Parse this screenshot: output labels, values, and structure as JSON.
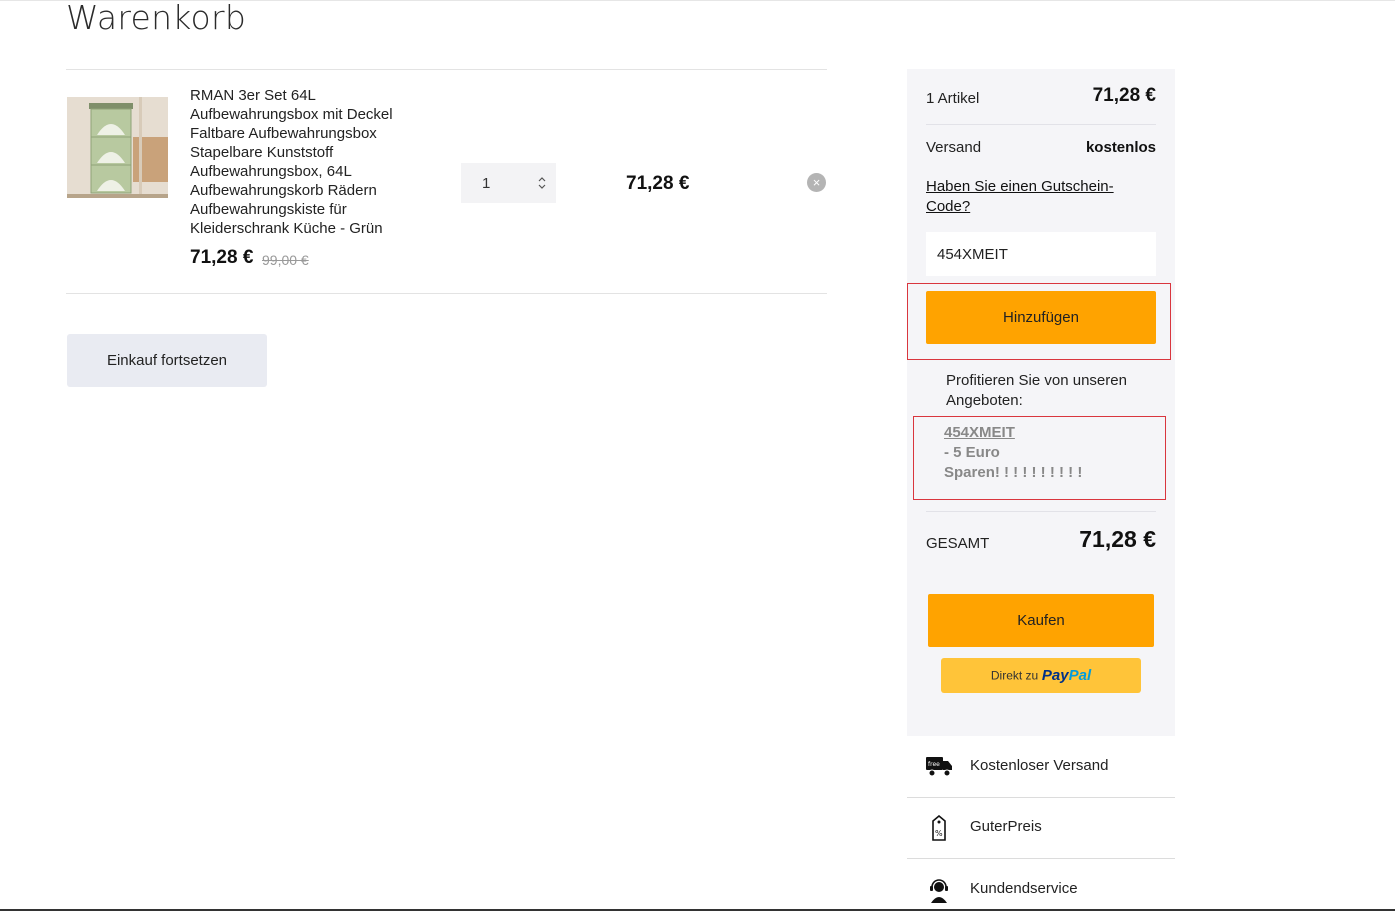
{
  "page": {
    "title": "Warenkorb"
  },
  "cart": {
    "item": {
      "name": "RMAN 3er Set 64L Aufbewahrungsbox mit Deckel Faltbare Aufbewahrungsbox Stapelbare Kunststoff Aufbewahrungsbox, 64L Aufbewahrungskorb Rädern Aufbewahrungskiste für Kleiderschrank Küche - Grün",
      "price": "71,28 €",
      "old_price": "99,00 €",
      "quantity": "1",
      "line_total": "71,28 €",
      "remove_symbol": "×"
    },
    "continue_label": "Einkauf fortsetzen"
  },
  "summary": {
    "items_label": "1 Artikel",
    "items_value": "71,28 €",
    "shipping_label": "Versand",
    "shipping_value": "kostenlos",
    "coupon_link": "Haben Sie einen Gutschein-Code?",
    "coupon_value": "454XMEIT",
    "add_label": "Hinzufügen",
    "offers_title": "Profitieren Sie von unseren Angeboten:",
    "offer_code": "454XMEIT",
    "offer_desc": "- 5 Euro",
    "offer_extra": "Sparen! ! ! ! ! ! ! ! ! !",
    "total_label": "GESAMT",
    "total_value": "71,28 €",
    "buy_label": "Kaufen",
    "paypal_prefix": "Direkt zu",
    "paypal_pay": "Pay",
    "paypal_pal": "Pal"
  },
  "features": [
    {
      "label": "Kostenloser Versand",
      "icon": "free-delivery-truck-icon",
      "icon_text": "free"
    },
    {
      "label": "GuterPreis",
      "icon": "price-tag-icon",
      "icon_text": "%"
    },
    {
      "label": "Kundendservice",
      "icon": "customer-service-icon"
    }
  ],
  "colors": {
    "accent": "#ffa300",
    "paypal": "#ffc439",
    "panel": "#f5f5f8",
    "highlight": "#d9363e"
  }
}
